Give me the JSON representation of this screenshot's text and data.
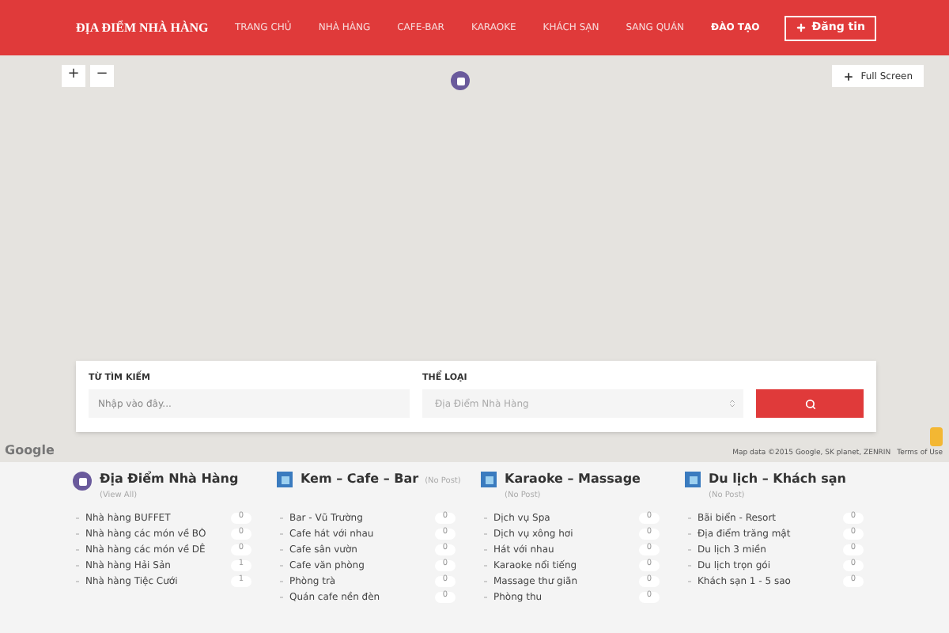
{
  "header": {
    "logo": "ĐỊA ĐIỂM NHÀ HÀNG",
    "nav": [
      {
        "label": "TRANG CHỦ",
        "selected": false
      },
      {
        "label": "NHÀ HÀNG",
        "selected": false
      },
      {
        "label": "CAFE-BAR",
        "selected": false
      },
      {
        "label": "KARAOKE",
        "selected": false
      },
      {
        "label": "KHÁCH SẠN",
        "selected": false
      },
      {
        "label": "SANG QUÁN",
        "selected": false
      },
      {
        "label": "ĐÀO TẠO",
        "selected": true
      }
    ],
    "post_button": "Đăng tin"
  },
  "map": {
    "zoom_in": "+",
    "zoom_out": "−",
    "fullscreen": "Full Screen",
    "logo": "Google",
    "attribution": "Map data ©2015 Google, SK planet, ZENRIN",
    "terms": "Terms of Use"
  },
  "search": {
    "keyword_label": "TỪ TÌM KIẾM",
    "keyword_placeholder": "Nhập vào đây...",
    "category_label": "THỂ LOẠI",
    "category_value": "Địa Điểm Nhà Hàng"
  },
  "categories": [
    {
      "kind": "round",
      "title": "Địa Điểm Nhà Hàng",
      "note": "(View All)",
      "items": [
        {
          "label": "Nhà hàng BUFFET",
          "count": "0"
        },
        {
          "label": "Nhà hàng các món về BÒ",
          "count": "0"
        },
        {
          "label": "Nhà hàng các món về DÊ",
          "count": "0"
        },
        {
          "label": "Nhà hàng Hải Sản",
          "count": "1"
        },
        {
          "label": "Nhà hàng Tiệc Cưới",
          "count": "1"
        }
      ]
    },
    {
      "kind": "square",
      "title": "Kem – Cafe – Bar",
      "note": "(No Post)",
      "items": [
        {
          "label": "Bar - Vũ Trường",
          "count": "0"
        },
        {
          "label": "Cafe hát với nhau",
          "count": "0"
        },
        {
          "label": "Cafe sân vườn",
          "count": "0"
        },
        {
          "label": "Cafe văn phòng",
          "count": "0"
        },
        {
          "label": "Phòng trà",
          "count": "0"
        },
        {
          "label": "Quán cafe nền đèn",
          "count": "0"
        }
      ]
    },
    {
      "kind": "square",
      "title": "Karaoke – Massage",
      "note": "(No Post)",
      "items": [
        {
          "label": "Dịch vụ Spa",
          "count": "0"
        },
        {
          "label": "Dịch vụ xông hơi",
          "count": "0"
        },
        {
          "label": "Hát với nhau",
          "count": "0"
        },
        {
          "label": "Karaoke nổi tiếng",
          "count": "0"
        },
        {
          "label": "Massage thư giãn",
          "count": "0"
        },
        {
          "label": "Phòng thu",
          "count": "0"
        }
      ]
    },
    {
      "kind": "square",
      "title": "Du lịch – Khách sạn",
      "note": "(No Post)",
      "items": [
        {
          "label": "Bãi biển - Resort",
          "count": "0"
        },
        {
          "label": "Địa điểm trăng mật",
          "count": "0"
        },
        {
          "label": "Du lịch 3 miền",
          "count": "0"
        },
        {
          "label": "Du lịch trọn gói",
          "count": "0"
        },
        {
          "label": "Khách sạn 1 - 5 sao",
          "count": "0"
        }
      ]
    }
  ]
}
